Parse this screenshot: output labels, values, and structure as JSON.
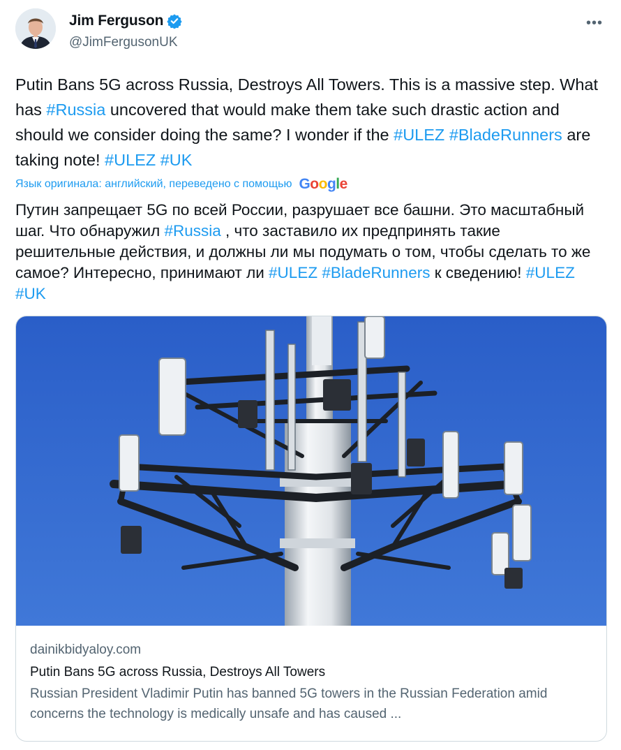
{
  "author": {
    "name": "Jim Ferguson",
    "handle": "@JimFergusonUK"
  },
  "more_menu": "•••",
  "tweet": {
    "parts": [
      {
        "text": "Putin Bans 5G across Russia, Destroys All Towers. This is a massive step. What has "
      },
      {
        "tag": "#Russia"
      },
      {
        "text": " uncovered that would make them take such drastic action and should we consider doing the same? I wonder if the "
      },
      {
        "tag": "#ULEZ"
      },
      {
        "text": " "
      },
      {
        "tag": "#BladeRunners"
      },
      {
        "text": " are taking note! "
      },
      {
        "tag": "#ULEZ"
      },
      {
        "text": " "
      },
      {
        "tag": "#UK"
      }
    ]
  },
  "translation": {
    "note": "Язык оригинала: английский, переведено с помощью",
    "provider": "Google",
    "parts": [
      {
        "text": "Путин запрещает 5G по всей России, разрушает все башни. Это масштабный шаг. Что обнаружил "
      },
      {
        "tag": "#Russia"
      },
      {
        "text": " , что заставило их предпринять такие решительные действия, и должны ли мы подумать о том, чтобы сделать то же самое? Интересно, принимают ли "
      },
      {
        "tag": "#ULEZ"
      },
      {
        "text": " "
      },
      {
        "tag": "#BladeRunners"
      },
      {
        "text": " к сведению! "
      },
      {
        "tag": "#ULEZ"
      },
      {
        "text": " "
      },
      {
        "tag": "#UK"
      }
    ]
  },
  "link_card": {
    "domain": "dainikbidyaloy.com",
    "title": "Putin Bans 5G across Russia, Destroys All Towers",
    "description": "Russian President Vladimir Putin has banned 5G towers in the Russian Federation amid concerns the technology is medically unsafe and has caused ..."
  },
  "colors": {
    "link": "#1d9bf0",
    "muted": "#536471",
    "sky": "#2f63c9"
  }
}
